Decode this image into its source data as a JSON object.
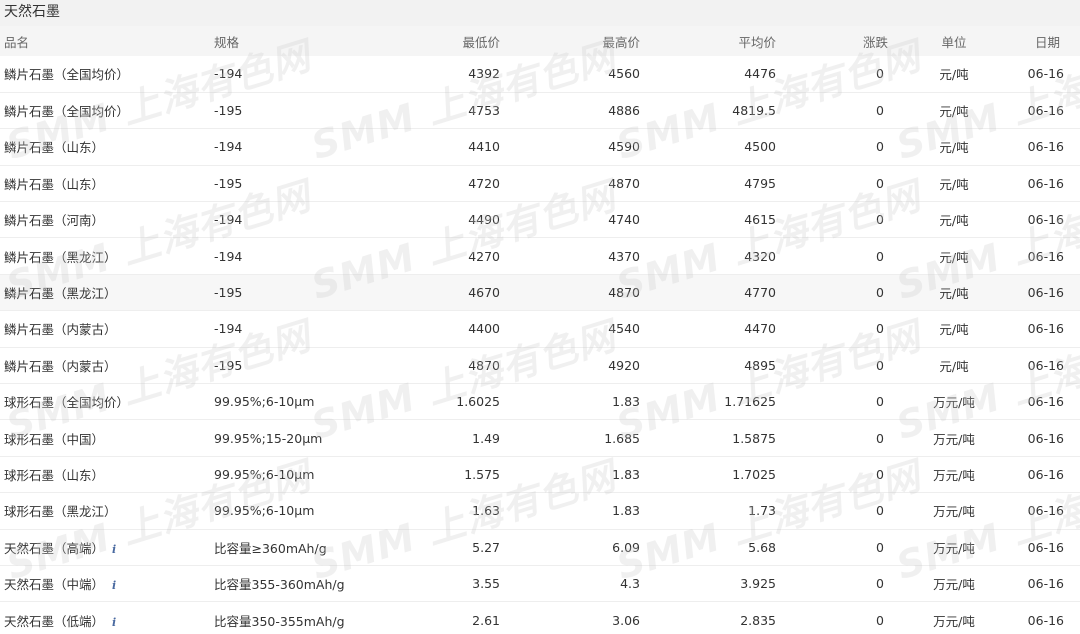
{
  "title": "天然石墨",
  "watermark_text": "SMM 上海有色网",
  "columns": [
    "品名",
    "规格",
    "最低价",
    "最高价",
    "平均价",
    "涨跌",
    "单位",
    "日期"
  ],
  "rows": [
    {
      "name": "鳞片石墨（全国均价）",
      "spec": "-194",
      "low": "4392",
      "high": "4560",
      "avg": "4476",
      "change": "0",
      "unit": "元/吨",
      "date": "06-16",
      "info": false
    },
    {
      "name": "鳞片石墨（全国均价）",
      "spec": "-195",
      "low": "4753",
      "high": "4886",
      "avg": "4819.5",
      "change": "0",
      "unit": "元/吨",
      "date": "06-16",
      "info": false
    },
    {
      "name": "鳞片石墨（山东）",
      "spec": "-194",
      "low": "4410",
      "high": "4590",
      "avg": "4500",
      "change": "0",
      "unit": "元/吨",
      "date": "06-16",
      "info": false
    },
    {
      "name": "鳞片石墨（山东）",
      "spec": "-195",
      "low": "4720",
      "high": "4870",
      "avg": "4795",
      "change": "0",
      "unit": "元/吨",
      "date": "06-16",
      "info": false
    },
    {
      "name": "鳞片石墨（河南）",
      "spec": "-194",
      "low": "4490",
      "high": "4740",
      "avg": "4615",
      "change": "0",
      "unit": "元/吨",
      "date": "06-16",
      "info": false
    },
    {
      "name": "鳞片石墨（黑龙江）",
      "spec": "-194",
      "low": "4270",
      "high": "4370",
      "avg": "4320",
      "change": "0",
      "unit": "元/吨",
      "date": "06-16",
      "info": false
    },
    {
      "name": "鳞片石墨（黑龙江）",
      "spec": "-195",
      "low": "4670",
      "high": "4870",
      "avg": "4770",
      "change": "0",
      "unit": "元/吨",
      "date": "06-16",
      "info": false,
      "highlighted": true
    },
    {
      "name": "鳞片石墨（内蒙古）",
      "spec": "-194",
      "low": "4400",
      "high": "4540",
      "avg": "4470",
      "change": "0",
      "unit": "元/吨",
      "date": "06-16",
      "info": false
    },
    {
      "name": "鳞片石墨（内蒙古）",
      "spec": "-195",
      "low": "4870",
      "high": "4920",
      "avg": "4895",
      "change": "0",
      "unit": "元/吨",
      "date": "06-16",
      "info": false
    },
    {
      "name": "球形石墨（全国均价）",
      "spec": "99.95%;6-10μm",
      "low": "1.6025",
      "high": "1.83",
      "avg": "1.71625",
      "change": "0",
      "unit": "万元/吨",
      "date": "06-16",
      "info": false
    },
    {
      "name": "球形石墨（中国）",
      "spec": "99.95%;15-20μm",
      "low": "1.49",
      "high": "1.685",
      "avg": "1.5875",
      "change": "0",
      "unit": "万元/吨",
      "date": "06-16",
      "info": false
    },
    {
      "name": "球形石墨（山东）",
      "spec": "99.95%;6-10μm",
      "low": "1.575",
      "high": "1.83",
      "avg": "1.7025",
      "change": "0",
      "unit": "万元/吨",
      "date": "06-16",
      "info": false
    },
    {
      "name": "球形石墨（黑龙江）",
      "spec": "99.95%;6-10μm",
      "low": "1.63",
      "high": "1.83",
      "avg": "1.73",
      "change": "0",
      "unit": "万元/吨",
      "date": "06-16",
      "info": false
    },
    {
      "name": "天然石墨（高端）",
      "spec": "比容量≥360mAh/g",
      "low": "5.27",
      "high": "6.09",
      "avg": "5.68",
      "change": "0",
      "unit": "万元/吨",
      "date": "06-16",
      "info": true
    },
    {
      "name": "天然石墨（中端）",
      "spec": "比容量355-360mAh/g",
      "low": "3.55",
      "high": "4.3",
      "avg": "3.925",
      "change": "0",
      "unit": "万元/吨",
      "date": "06-16",
      "info": true
    },
    {
      "name": "天然石墨（低端）",
      "spec": "比容量350-355mAh/g",
      "low": "2.61",
      "high": "3.06",
      "avg": "2.835",
      "change": "0",
      "unit": "万元/吨",
      "date": "06-16",
      "info": true
    }
  ],
  "colors": {
    "header_bg": "#f5f5f5",
    "title_bg": "#f2f2f2",
    "row_highlight": "#f7f7f7",
    "info_icon": "#4a6aa0"
  }
}
